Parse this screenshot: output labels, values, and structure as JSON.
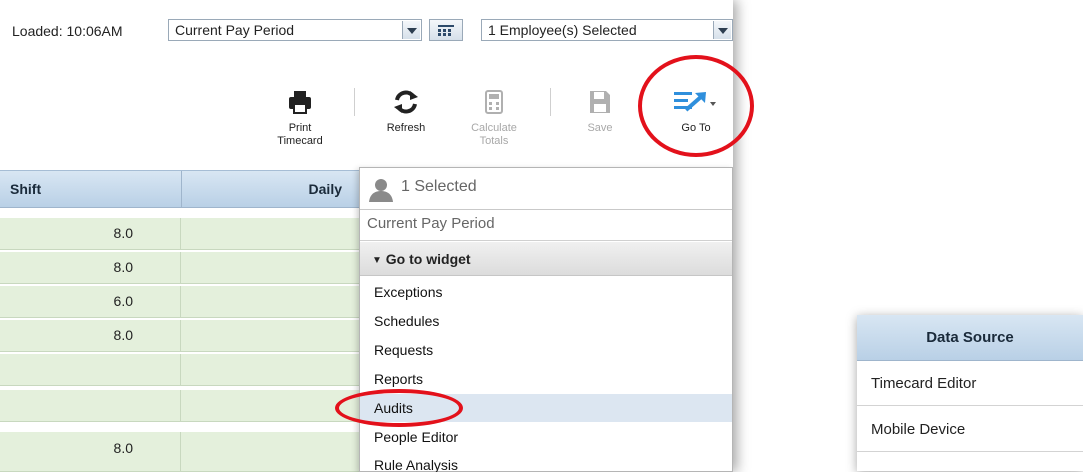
{
  "header": {
    "loaded_text": "Loaded: 10:06AM",
    "period_select": "Current Pay Period",
    "employee_select": "1 Employee(s) Selected"
  },
  "toolbar": {
    "print": [
      "Print",
      "Timecard"
    ],
    "refresh": "Refresh",
    "calculate": [
      "Calculate",
      "Totals"
    ],
    "save": "Save",
    "goto": "Go To"
  },
  "grid": {
    "columns": [
      "Shift",
      "Daily"
    ],
    "rows": [
      "8.0",
      "8.0",
      "6.0",
      "8.0",
      "",
      "",
      "8.0"
    ]
  },
  "goto_menu": {
    "selected": "1 Selected",
    "period": "Current Pay Period",
    "section_header": "Go to widget",
    "items": [
      "Exceptions",
      "Schedules",
      "Requests",
      "Reports",
      "Audits",
      "People Editor",
      "Rule Analysis"
    ],
    "highlighted_item": "Audits"
  },
  "data_source_card": {
    "header": "Data Source",
    "rows": [
      "Timecard Editor",
      "Mobile Device"
    ]
  },
  "colors": {
    "callout_red": "#e3111b",
    "header_blue": "#b9d0e6",
    "row_green": "#e4f0dc",
    "goto_blue": "#2f8fdc"
  }
}
